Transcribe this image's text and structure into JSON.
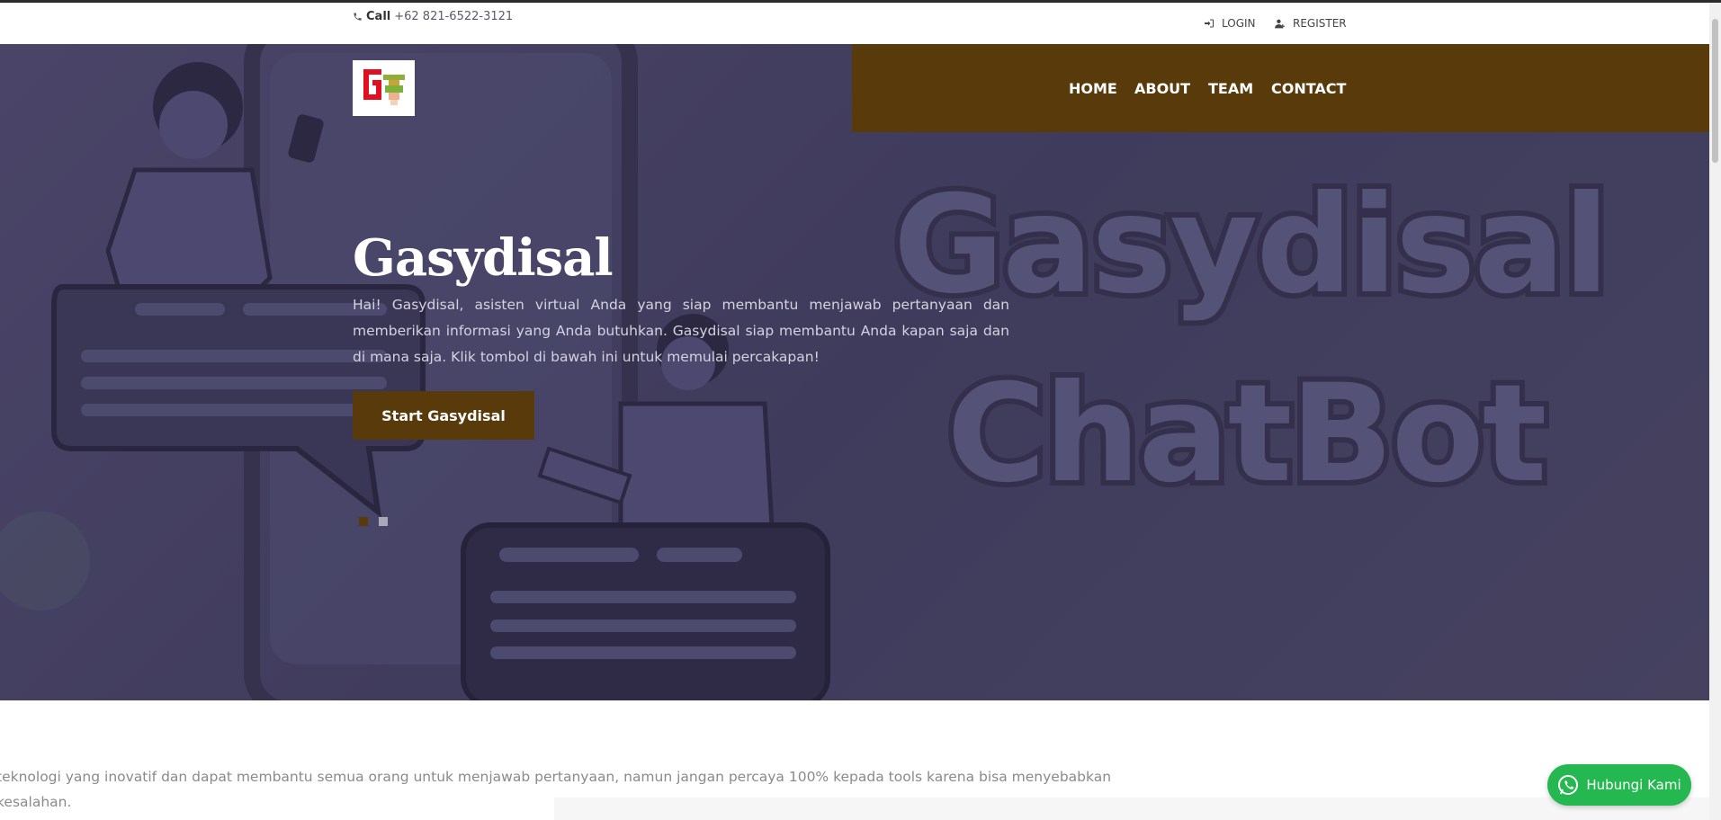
{
  "topbar": {
    "call_label": "Call",
    "phone": "+62 821-6522-3121",
    "login_label": "LOGIN",
    "register_label": "REGISTER"
  },
  "nav": {
    "items": [
      "HOME",
      "ABOUT",
      "TEAM",
      "CONTACT"
    ]
  },
  "hero": {
    "title": "Gasydisal",
    "description": "Hai! Gasydisal, asisten virtual Anda yang siap membantu menjawab pertanyaan dan memberikan informasi yang Anda butuhkan. Gasydisal siap membantu Anda kapan saja dan di mana saja. Klik tombol di bawah ini untuk memulai percakapan!",
    "button_label": "Start Gasydisal",
    "graphic_text_line1": "Gasydisal",
    "graphic_text_line2": "ChatBot",
    "slide_count": 2,
    "active_slide": 1
  },
  "below": {
    "text": "teknologi yang inovatif dan dapat membantu semua orang untuk menjawab pertanyaan, namun jangan percaya 100% kepada tools karena bisa menyebabkan kesalahan."
  },
  "whatsapp": {
    "label": "Hubungi Kami",
    "icon": "whatsapp-icon"
  },
  "colors": {
    "brand_brown": "#593a0b",
    "hero_bg": "#45415f",
    "whatsapp_green": "#25b850"
  }
}
